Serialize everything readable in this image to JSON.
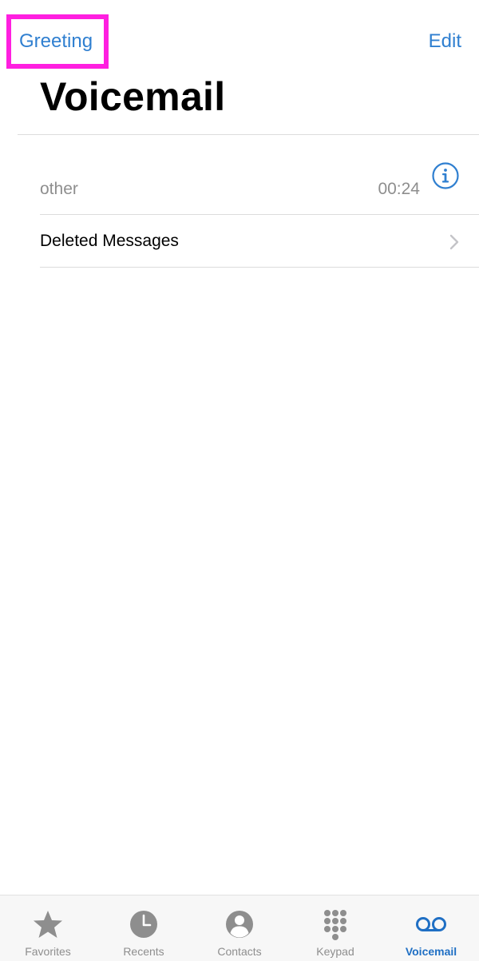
{
  "nav": {
    "left_label": "Greeting",
    "right_label": "Edit"
  },
  "page": {
    "title": "Voicemail"
  },
  "voicemails": [
    {
      "caller": "other",
      "duration": "00:24"
    }
  ],
  "deleted_messages": {
    "label": "Deleted Messages"
  },
  "tabbar": {
    "tabs": [
      {
        "label": "Favorites",
        "icon": "star-icon"
      },
      {
        "label": "Recents",
        "icon": "clock-icon"
      },
      {
        "label": "Contacts",
        "icon": "person-icon"
      },
      {
        "label": "Keypad",
        "icon": "keypad-icon"
      },
      {
        "label": "Voicemail",
        "icon": "voicemail-icon",
        "active": true
      }
    ]
  },
  "colors": {
    "accent": "#2f7fd0",
    "highlight": "#ff1fe0",
    "secondary_text": "#8e8e8e"
  }
}
